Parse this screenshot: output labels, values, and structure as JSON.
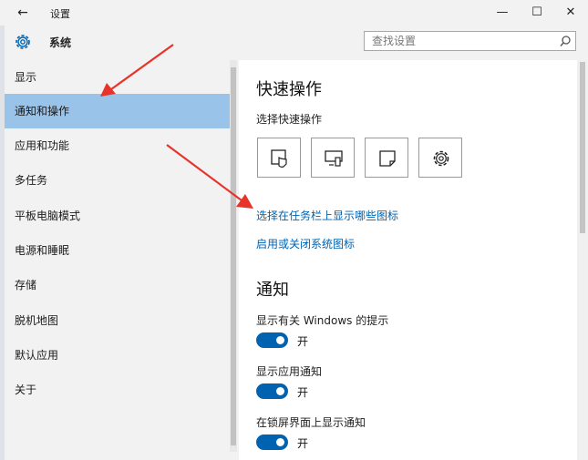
{
  "titlebar": {
    "back_glyph": "←",
    "title": "设置",
    "minimize_glyph": "—",
    "maximize_glyph": "☐",
    "close_glyph": "✕"
  },
  "header": {
    "title": "系统",
    "icon": "gear-icon"
  },
  "search": {
    "placeholder": "查找设置",
    "icon": "search-icon"
  },
  "sidebar": {
    "items": [
      {
        "label": "显示"
      },
      {
        "label": "通知和操作",
        "active": true
      },
      {
        "label": "应用和功能"
      },
      {
        "label": "多任务"
      },
      {
        "label": "平板电脑模式"
      },
      {
        "label": "电源和睡眠"
      },
      {
        "label": "存储"
      },
      {
        "label": "脱机地图"
      },
      {
        "label": "默认应用"
      },
      {
        "label": "关于"
      }
    ]
  },
  "content": {
    "quick_actions": {
      "heading": "快速操作",
      "subheading": "选择快速操作",
      "tiles": [
        {
          "icon": "tablet-mode-icon"
        },
        {
          "icon": "project-display-icon"
        },
        {
          "icon": "note-icon"
        },
        {
          "icon": "settings-gear-icon"
        }
      ],
      "link_taskbar_icons": "选择在任务栏上显示哪些图标",
      "link_system_icons": "启用或关闭系统图标"
    },
    "notifications": {
      "heading": "通知",
      "settings": [
        {
          "label": "显示有关 Windows 的提示",
          "state": "开"
        },
        {
          "label": "显示应用通知",
          "state": "开"
        },
        {
          "label": "在锁屏界面上显示通知",
          "state": "开"
        }
      ]
    }
  },
  "colors": {
    "accent": "#0063b1",
    "selected": "#99c3e9",
    "annotation": "#e8332a"
  }
}
